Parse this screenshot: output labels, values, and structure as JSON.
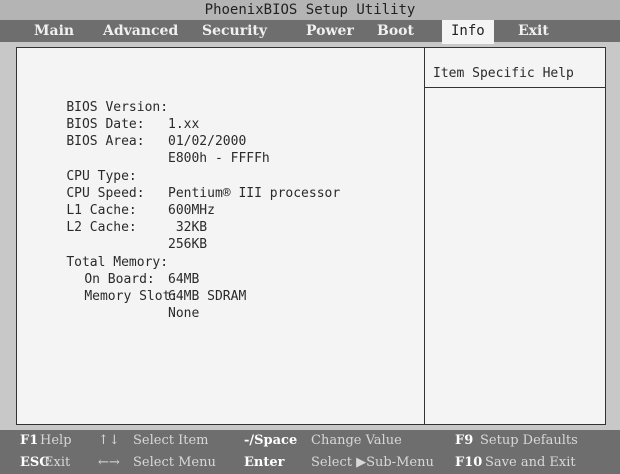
{
  "title": "PhoenixBIOS Setup Utility",
  "menu": {
    "items": [
      "Main",
      "Advanced",
      "Security",
      "Power",
      "Boot",
      "Info",
      "Exit"
    ],
    "active": "Info"
  },
  "help": {
    "title": "Item Specific Help"
  },
  "info": [
    {
      "label": "BIOS Version:",
      "value": "1.xx"
    },
    {
      "label": "BIOS Date:",
      "value": "01/02/2000"
    },
    {
      "label": "BIOS Area:",
      "value": "E800h - FFFFh"
    },
    {
      "label": "CPU Type:",
      "value": "Pentium® III processor"
    },
    {
      "label": "CPU Speed:",
      "value": "600MHz"
    },
    {
      "label": "L1 Cache:",
      "value": " 32KB"
    },
    {
      "label": "L2 Cache:",
      "value": "256KB"
    },
    {
      "label": "Total Memory:",
      "value": "64MB"
    },
    {
      "label": "On Board:",
      "value": "64MB SDRAM"
    },
    {
      "label": "Memory Slot:",
      "value": "None"
    }
  ],
  "status": {
    "row1": {
      "k1": "F1",
      "t1": "Help",
      "g1": "↑↓",
      "t2": "Select Item",
      "k2": "-/Space",
      "t3": "Change Value",
      "k3": "F9",
      "t4": "Setup Defaults"
    },
    "row2": {
      "k1": "ESC",
      "t1": "Exit",
      "g1": "←→",
      "t2": "Select Menu",
      "k2": "Enter",
      "t3": "Select ▶Sub-Menu",
      "k3": "F10",
      "t4": "Save and Exit"
    }
  }
}
